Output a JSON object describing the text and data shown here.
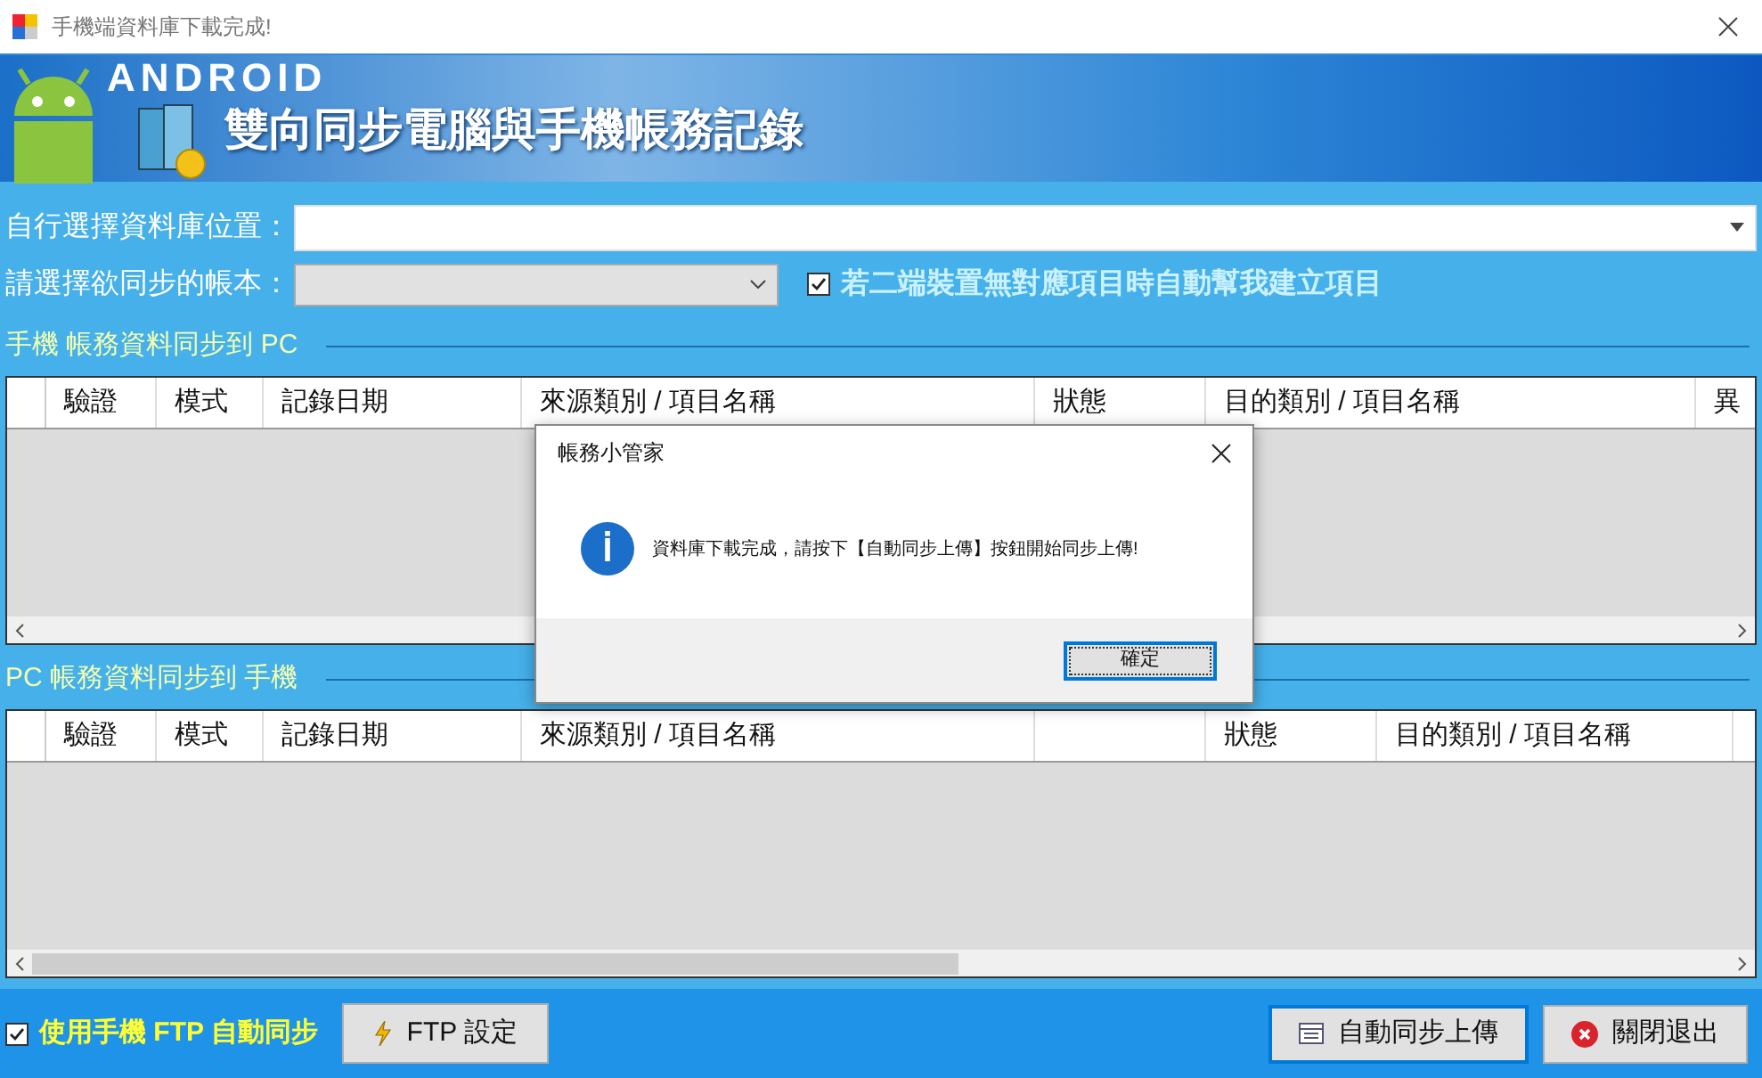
{
  "window": {
    "title": "手機端資料庫下載完成!"
  },
  "banner": {
    "logo_text": "ANDROID",
    "title": "雙向同步電腦與手機帳務記錄"
  },
  "form": {
    "db_label": "自行選擇資料庫位置：",
    "account_label": "請選擇欲同步的帳本：",
    "auto_create": {
      "label": "若二端裝置無對應項目時自動幫我建立項目",
      "checked": true
    }
  },
  "tables": [
    {
      "title": "手機 帳務資料同步到 PC",
      "columns": [
        {
          "label": "驗證"
        },
        {
          "label": "模式"
        },
        {
          "label": "記錄日期"
        },
        {
          "label": "來源類別 / 項目名稱"
        },
        {
          "label": "狀態"
        },
        {
          "label": "目的類別 / 項目名稱"
        },
        {
          "label": "異"
        }
      ]
    },
    {
      "title": "PC 帳務資料同步到 手機",
      "columns": [
        {
          "label": "驗證"
        },
        {
          "label": "模式"
        },
        {
          "label": "記錄日期"
        },
        {
          "label": "來源類別 / 項目名稱"
        },
        {},
        {
          "label": "狀態"
        },
        {
          "label": "目的類別 / 項目名稱"
        }
      ]
    }
  ],
  "bottom": {
    "ftp_sync": {
      "label": "使用手機 FTP 自動同步",
      "checked": true
    },
    "ftp_button": "FTP 設定",
    "upload_button": "自動同步上傳",
    "exit_button": "關閉退出"
  },
  "dialog": {
    "title": "帳務小管家",
    "message": "資料庫下載完成，請按下【自動同步上傳】按鈕開始同步上傳!",
    "ok_button": "確定"
  }
}
